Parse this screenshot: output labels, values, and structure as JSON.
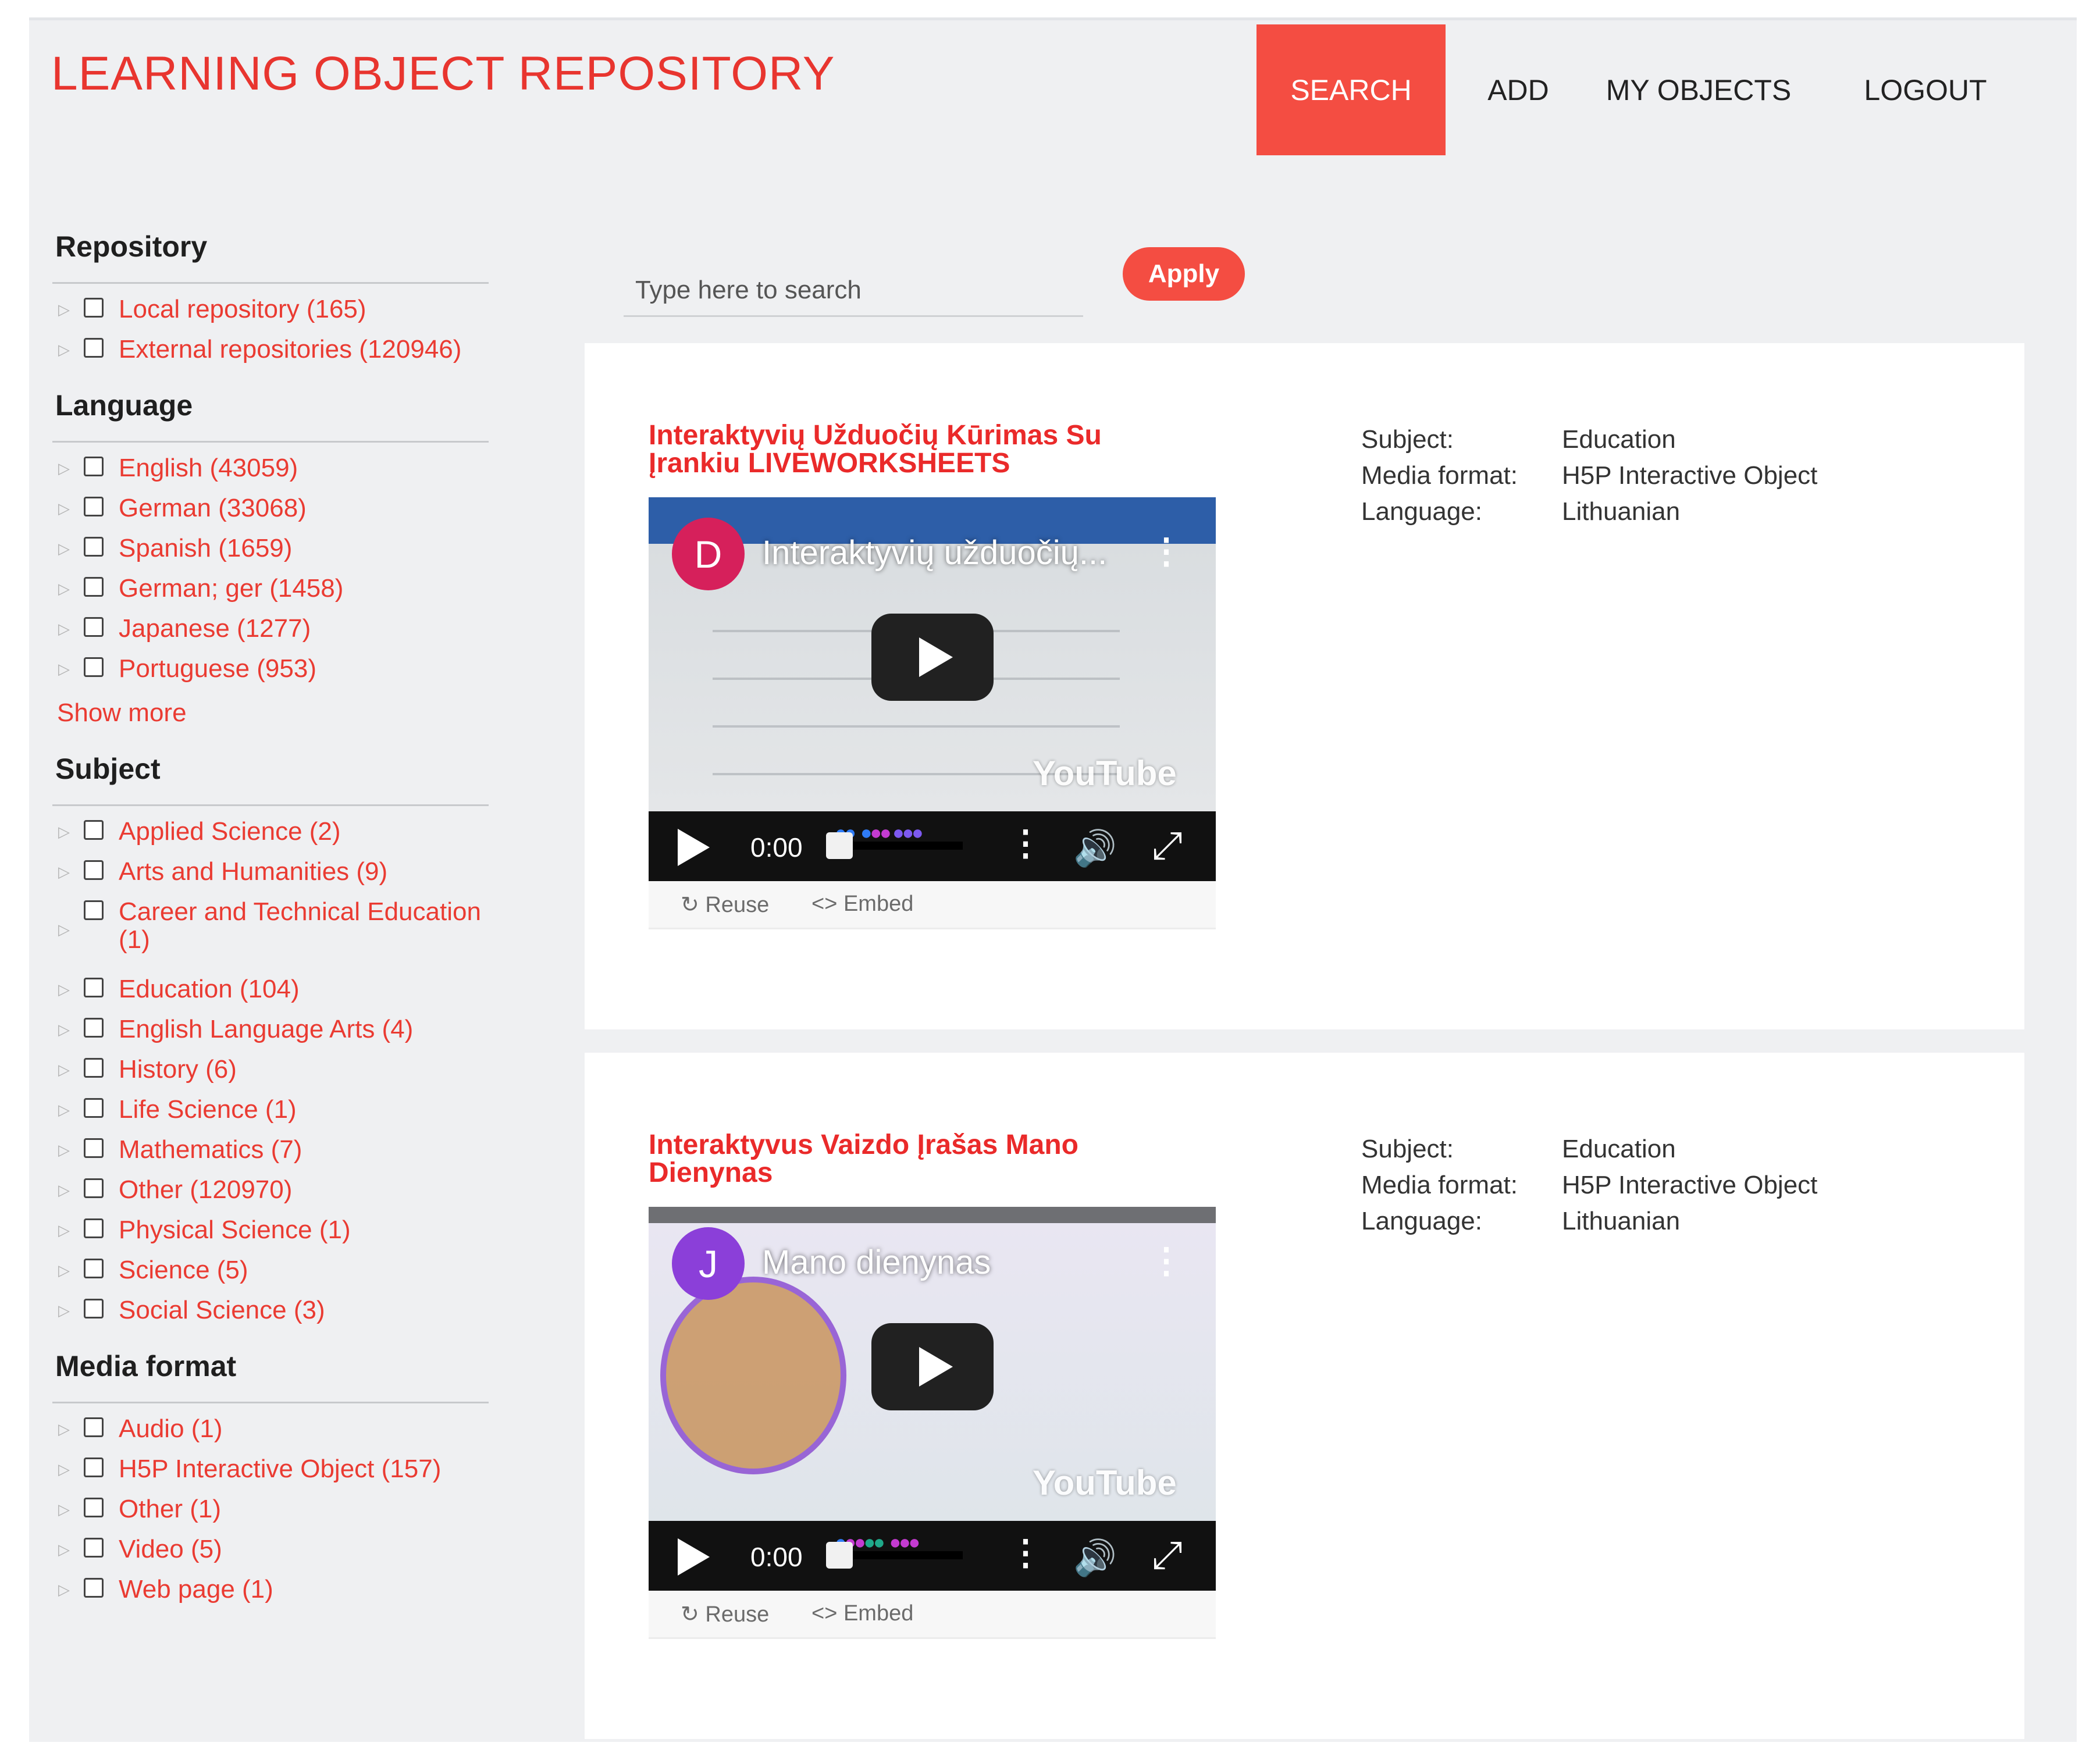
{
  "header": {
    "brand": "LEARNING OBJECT REPOSITORY",
    "nav": {
      "search": "SEARCH",
      "add": "ADD",
      "my_objects": "MY OBJECTS",
      "logout": "LOGOUT"
    },
    "accent_color": "#f44d42"
  },
  "search": {
    "placeholder": "Type here to search",
    "value": "",
    "apply_label": "Apply"
  },
  "filters": {
    "repository": {
      "title": "Repository",
      "items": [
        "Local repository (165)",
        "External repositories (120946)"
      ]
    },
    "language": {
      "title": "Language",
      "items": [
        "English (43059)",
        "German (33068)",
        "Spanish (1659)",
        "German; ger (1458)",
        "Japanese (1277)",
        "Portuguese (953)"
      ],
      "show_more": "Show more"
    },
    "subject": {
      "title": "Subject",
      "items": [
        "Applied Science (2)",
        "Arts and Humanities (9)",
        "Career and Technical Education (1)",
        "Education (104)",
        "English Language Arts (4)",
        "History (6)",
        "Life Science (1)",
        "Mathematics (7)",
        "Other (120970)",
        "Physical Science (1)",
        "Science (5)",
        "Social Science (3)"
      ]
    },
    "media_format": {
      "title": "Media format",
      "items": [
        "Audio (1)",
        "H5P Interactive Object (157)",
        "Other (1)",
        "Video (5)",
        "Web page (1)"
      ]
    }
  },
  "results": [
    {
      "title": "Interaktyvių Užduočių Kūrimas Su Įrankiu LIVEWORKSHEETS",
      "video": {
        "avatar": "D",
        "title": "Interaktyvių užduočių...",
        "time": "0:00",
        "youtube": "YouTube",
        "reuse": "Reuse",
        "embed": "Embed"
      },
      "meta": {
        "subject_label": "Subject:",
        "subject": "Education",
        "format_label": "Media format:",
        "format": "H5P Interactive Object",
        "language_label": "Language:",
        "language": "Lithuanian"
      }
    },
    {
      "title": "Interaktyvus Vaizdo Įrašas Mano Dienynas",
      "video": {
        "avatar": "J",
        "title": "Mano dienynas",
        "time": "0:00",
        "youtube": "YouTube",
        "reuse": "Reuse",
        "embed": "Embed"
      },
      "meta": {
        "subject_label": "Subject:",
        "subject": "Education",
        "format_label": "Media format:",
        "format": "H5P Interactive Object",
        "language_label": "Language:",
        "language": "Lithuanian"
      }
    }
  ]
}
